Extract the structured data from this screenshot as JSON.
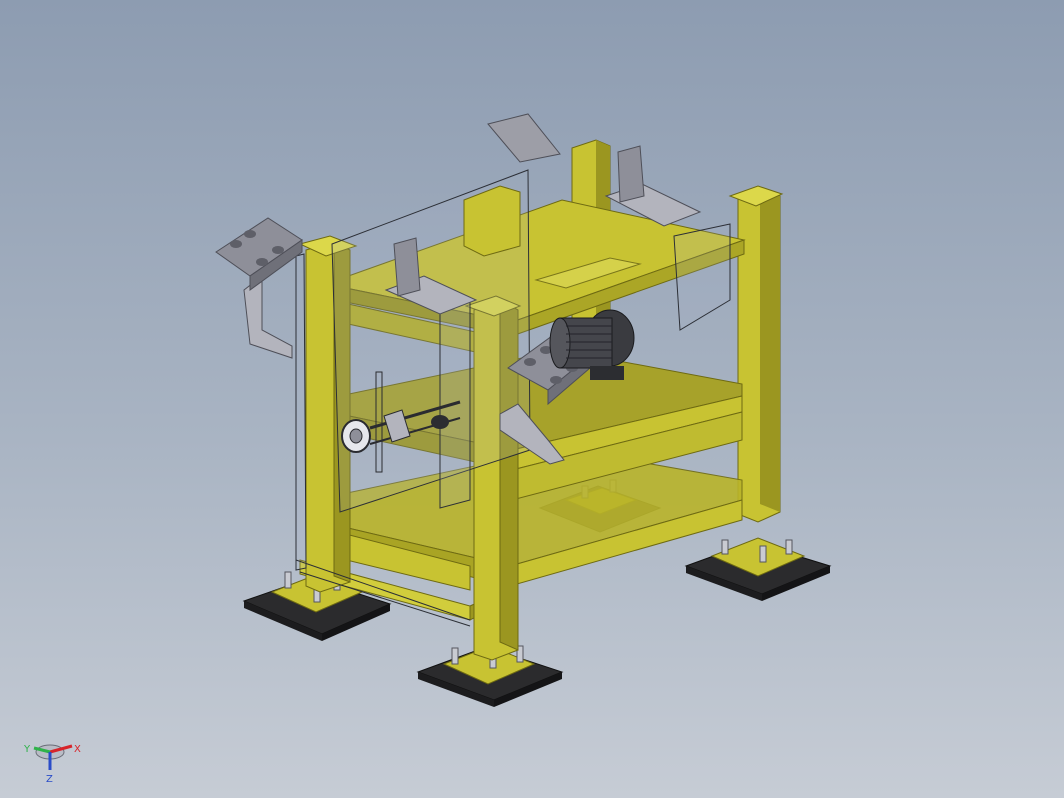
{
  "viewport": {
    "background_top": "#8d9cb1",
    "background_bottom": "#c6ccd5"
  },
  "model": {
    "frame_color": "#c8c332",
    "frame_dark": "#9b9620",
    "frame_light": "#dcd84a",
    "part_gray": "#8e8f99",
    "part_gray_light": "#b3b4bd",
    "base_plate_color": "#2b2b2d",
    "motor_color": "#3a3b40",
    "icon": "cad-assembly-icon"
  },
  "triad": {
    "x_label": "X",
    "y_label": "Y",
    "z_label": "Z",
    "x_color": "#d8242a",
    "y_color": "#2fb24a",
    "z_color": "#2a4cc8"
  }
}
